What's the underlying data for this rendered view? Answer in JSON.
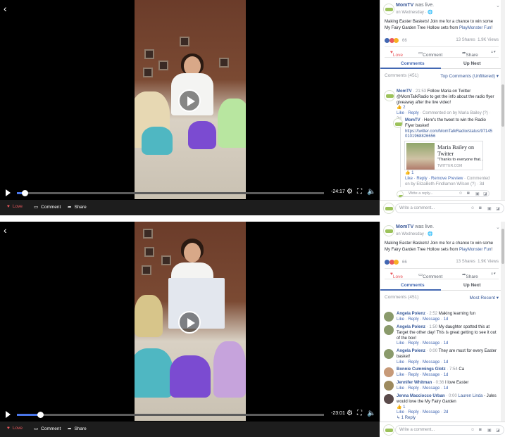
{
  "colors": {
    "accent": "#4267b2",
    "love": "#e9575c",
    "progress": "#4a76e8"
  },
  "panels": [
    {
      "time": "-24:17",
      "progress": 0.025,
      "actions": {
        "love": "Love",
        "comment": "Comment",
        "share": "Share"
      },
      "header": {
        "name": "MomTV",
        "status": "was live.",
        "sub": "on Wednesday · 🌐"
      },
      "post": {
        "text": "Making Easter Baskets! Join me for a chance to win some My Fairy Garden Tree Hollow sets from ",
        "link": "PlayMonster Fun",
        "end": "!"
      },
      "stats": {
        "reactions": "66",
        "shares": "13 Shares",
        "views": "1.9K Views"
      },
      "post_actions": {
        "love": "Love",
        "comment": "Comment",
        "share": "Share"
      },
      "tabs": {
        "comments": "Comments",
        "upnext": "Up Next"
      },
      "comments_header": {
        "count": "Comments (451)",
        "sort": "Top Comments (Unfiltered) ▾"
      },
      "comment1": {
        "author": "MomTV",
        "time": "· 21:53",
        "text": "Follow Maria on Twitter @MomTalkRadio to get the info about the radio flyer giveaway after the live video!",
        "likes": "2",
        "links": "Like · Reply",
        "meta": " · Commented on by Maria Bailey (?) · 2d"
      },
      "reply1": {
        "author": "MomTV",
        "text": " · Here's the tweet to win the Radio Flyer basket!",
        "url": "https://twitter.com/MomTalkRadio/status/971450101968826656",
        "likes": "1",
        "links": "Like · Reply · Remove Preview",
        "meta": " · Commented on by ElizaBeth-Findlamon Wilson (?) · 3d"
      },
      "card": {
        "title": "Maria Bailey on Twitter",
        "desc": "\"Thanks to everyone that...",
        "domain": "TWITTER.COM"
      },
      "reply_placeholder": "Write a reply...",
      "comment_placeholder": "Write a comment..."
    },
    {
      "time": "-23:01",
      "progress": 0.075,
      "actions": {
        "love": "Love",
        "comment": "Comment",
        "share": "Share"
      },
      "header": {
        "name": "MomTV",
        "status": "was live.",
        "sub": "on Wednesday · 🌐"
      },
      "post": {
        "text": "Making Easter Baskets! Join me for a chance to win some My Fairy Garden Tree Hollow sets from ",
        "link": "PlayMonster Fun",
        "end": "!"
      },
      "stats": {
        "reactions": "66",
        "shares": "13 Shares",
        "views": "1.9K Views"
      },
      "post_actions": {
        "love": "Love",
        "comment": "Comment",
        "share": "Share"
      },
      "tabs": {
        "comments": "Comments",
        "upnext": "Up Next"
      },
      "comments_header": {
        "count": "Comments (451)",
        "sort": "Most Recent ▾"
      },
      "list": [
        {
          "author": "Angela Polenz",
          "time": "· 2:52",
          "text": "Making learning fun",
          "links": "Like · Reply · Message · 1d"
        },
        {
          "author": "Angela Polenz",
          "time": "· 1:50",
          "text": "My daughter spotted this at Target the other day! This is great getting to see it out of the box!",
          "links": "Like · Reply · Message · 1d"
        },
        {
          "author": "Angela Polenz",
          "time": "· 0:00",
          "text": "They are must for every Easter basket!",
          "links": "Like · Reply · Message · 1d"
        },
        {
          "author": "Bonnie Cummings Glotz",
          "time": "· 7:54",
          "text": "Ca",
          "links": "Like · Reply · Message · 1d"
        },
        {
          "author": "Jennifer Whitman",
          "time": "· 0:36",
          "text": "I love Easter",
          "links": "Like · Reply · Message · 1d"
        },
        {
          "author": "Jenna Macciocco Urban",
          "time": "· 0:00",
          "mention": "Lauren Linda",
          "text": " - Jules would love the My Fairy Garden",
          "likes": "1",
          "links": "Like · Reply · Message · 2d"
        }
      ],
      "replies_link": "↳ 1 Reply",
      "comment_placeholder": "Write a comment..."
    }
  ]
}
